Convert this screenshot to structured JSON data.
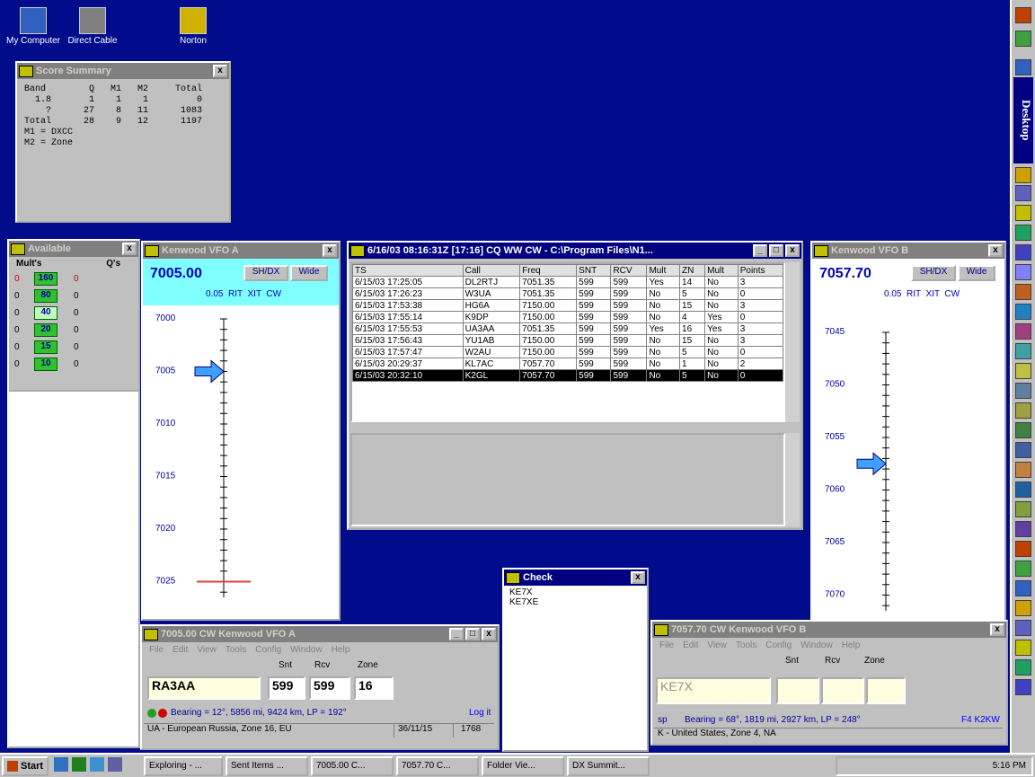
{
  "desktop": {
    "icons": [
      {
        "label": "My Computer",
        "color": "#3060c0"
      },
      {
        "label": "Direct Cable",
        "color": "#808080"
      },
      {
        "label": "Norton",
        "color": "#d0b000"
      }
    ]
  },
  "score": {
    "title": "Score Summary",
    "lines": [
      "Band        Q   M1   M2     Total",
      "  1.8       1    1    1         0",
      "    ?      27    8   11      1083",
      "Total      28    9   12      1197",
      "M1 = DXCC",
      "M2 = Zone"
    ]
  },
  "avail": {
    "title": "Available",
    "h1": "Mult's",
    "h2": "Q's",
    "rows": [
      [
        "0",
        "160",
        "0"
      ],
      [
        "0",
        "80",
        "0"
      ],
      [
        "0",
        "40",
        "0"
      ],
      [
        "0",
        "20",
        "0"
      ],
      [
        "0",
        "15",
        "0"
      ],
      [
        "0",
        "10",
        "0"
      ]
    ]
  },
  "vfoa": {
    "title": "Kenwood VFO A",
    "freq": "7005.00",
    "btn1": "SH/DX",
    "btn2": "Wide",
    "sub": "0.05  RIT  XIT  CW",
    "ticks": [
      "7000",
      "7005",
      "7010",
      "7015",
      "7020",
      "7025"
    ]
  },
  "vfob": {
    "title": "Kenwood VFO B",
    "freq": "7057.70",
    "btn1": "SH/DX",
    "btn2": "Wide",
    "sub": "0.05  RIT  XIT  CW",
    "ticks": [
      "7045",
      "7050",
      "7055",
      "7060",
      "7065",
      "7070"
    ]
  },
  "log": {
    "title": "6/16/03 08:16:31Z [17:16] CQ WW CW - C:\\Program Files\\N1...",
    "headers": [
      "TS",
      "Call",
      "Freq",
      "SNT",
      "RCV",
      "Mult",
      "ZN",
      "Mult",
      "Points"
    ],
    "rows": [
      [
        "6/15/03 17:25:05",
        "DL2RTJ",
        "7051.35",
        "599",
        "599",
        "Yes",
        "14",
        "No",
        "3"
      ],
      [
        "6/15/03 17:26:23",
        "W3UA",
        "7051.35",
        "599",
        "599",
        "No",
        "5",
        "No",
        "0"
      ],
      [
        "6/15/03 17:53:38",
        "HG6A",
        "7150.00",
        "599",
        "599",
        "No",
        "15",
        "No",
        "3"
      ],
      [
        "6/15/03 17:55:14",
        "K9DP",
        "7150.00",
        "599",
        "599",
        "No",
        "4",
        "Yes",
        "0"
      ],
      [
        "6/15/03 17:55:53",
        "UA3AA",
        "7051.35",
        "599",
        "599",
        "Yes",
        "16",
        "Yes",
        "3"
      ],
      [
        "6/15/03 17:56:43",
        "YU1AB",
        "7150.00",
        "599",
        "599",
        "No",
        "15",
        "No",
        "3"
      ],
      [
        "6/15/03 17:57:47",
        "W2AU",
        "7150.00",
        "599",
        "599",
        "No",
        "5",
        "No",
        "0"
      ],
      [
        "6/15/03 20:29:37",
        "KL7AC",
        "7057.70",
        "599",
        "599",
        "No",
        "1",
        "No",
        "2"
      ],
      [
        "6/15/03 20:32:10",
        "K2GL",
        "7057.70",
        "599",
        "599",
        "No",
        "5",
        "No",
        "0"
      ]
    ]
  },
  "check": {
    "title": "Check",
    "items": [
      "KE7X",
      "KE7XE"
    ]
  },
  "entryA": {
    "title": "7005.00 CW Kenwood VFO A",
    "menu": [
      "File",
      "Edit",
      "View",
      "Tools",
      "Config",
      "Window",
      "Help"
    ],
    "snt_lbl": "Snt",
    "rcv_lbl": "Rcv",
    "zone_lbl": "Zone",
    "call": "RA3AA",
    "snt": "599",
    "rcv": "599",
    "zone": "16",
    "bearing": "Bearing = 12°, 5856  mi, 9424 km, LP = 192°",
    "logit": "Log it",
    "status": "UA - European Russia, Zone 16, EU",
    "s2": "36/11/15",
    "s3": "1768"
  },
  "entryB": {
    "title": "7057.70 CW Kenwood VFO B",
    "menu": [
      "File",
      "Edit",
      "View",
      "Tools",
      "Config",
      "Window",
      "Help"
    ],
    "snt_lbl": "Snt",
    "rcv_lbl": "Rcv",
    "zone_lbl": "Zone",
    "call": "KE7X",
    "sp": "sp",
    "bearing": "Bearing = 68°, 1819  mi, 2927 km, LP = 248°",
    "f4": "F4 K2KW",
    "status": "K - United States, Zone 4, NA"
  },
  "side": {
    "label": "Desktop"
  },
  "taskbar": {
    "start": "Start",
    "tasks": [
      "Exploring - ...",
      "Sent Items ...",
      "7005.00 C...",
      "7057.70 C...",
      "Folder Vie...",
      "DX Summit..."
    ],
    "time": "5:16 PM"
  }
}
